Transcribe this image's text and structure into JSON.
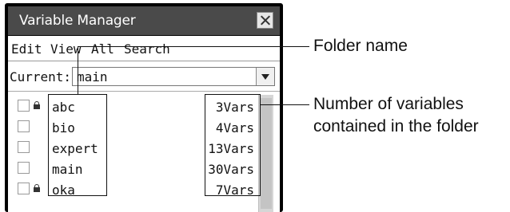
{
  "window": {
    "title": "Variable Manager",
    "close_icon": "close-icon"
  },
  "menu": [
    "Edit",
    "View",
    "All",
    "Search"
  ],
  "current": {
    "label": "Current:",
    "value": "main"
  },
  "folders": [
    {
      "name": "abc",
      "count": "3Vars",
      "locked": true
    },
    {
      "name": "bio",
      "count": "4Vars",
      "locked": false
    },
    {
      "name": "expert",
      "count": "13Vars",
      "locked": false
    },
    {
      "name": "main",
      "count": "30Vars",
      "locked": false
    },
    {
      "name": "oka",
      "count": "7Vars",
      "locked": true
    }
  ],
  "annotations": {
    "folder_name": "Folder name",
    "num_vars_line1": "Number of variables",
    "num_vars_line2": "contained in the folder"
  }
}
